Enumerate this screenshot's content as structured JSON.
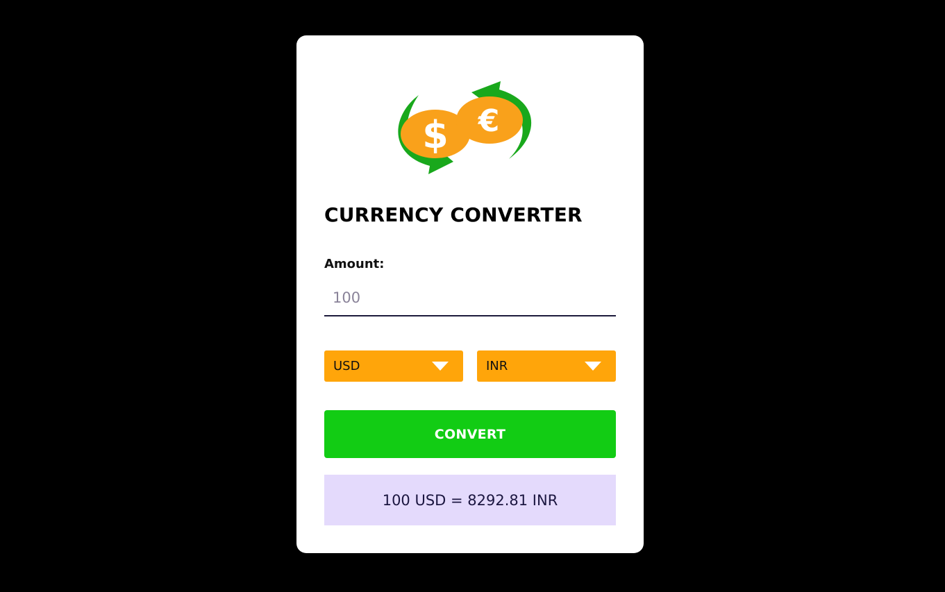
{
  "app": {
    "title": "CURRENCY CONVERTER"
  },
  "logo": {
    "icon": "currency-exchange-icon",
    "colors": {
      "coin": "#f9a11b",
      "arrow": "#19a81c"
    }
  },
  "form": {
    "amount_label": "Amount:",
    "amount_value": "100",
    "from_currency": "USD",
    "to_currency": "INR",
    "convert_label": "CONVERT",
    "result_text": "100 USD = 8292.81 INR"
  },
  "colors": {
    "select_bg": "#ffa50a",
    "button_bg": "#12cc14",
    "result_bg": "#e4dafc",
    "page_bg": "#000000"
  }
}
